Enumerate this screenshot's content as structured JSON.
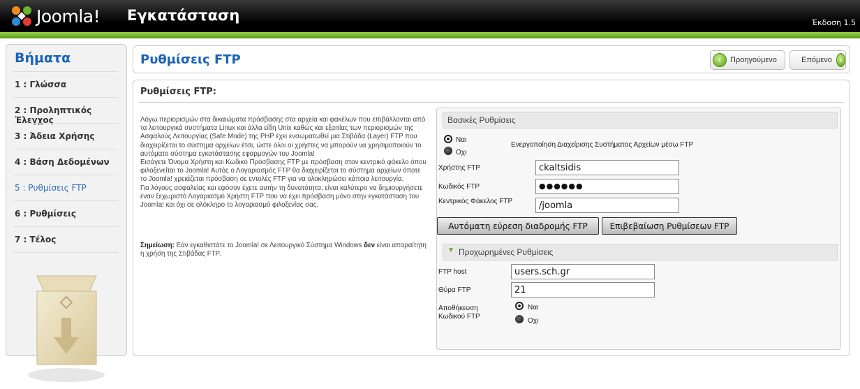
{
  "header": {
    "brand": "Joomla!",
    "title": "Εγκατάσταση",
    "version": "Έκδοση 1.5"
  },
  "sidebar": {
    "heading": "Βήματα",
    "steps": [
      "1 : Γλώσσα",
      "2 : Προληπτικός Έλεγχος",
      "3 : Άδεια Χρήσης",
      "4 : Βάση Δεδομένων",
      "5 : Ρυθμίσεις FTP",
      "6 : Ρυθμίσεις",
      "7 : Τέλος"
    ]
  },
  "topbar": {
    "title": "Ρυθμίσεις FTP",
    "prev_label": "Προηγούμενο",
    "next_label": "Επόμενο"
  },
  "main": {
    "heading": "Ρυθμίσεις FTP:",
    "description": "Λόγω περιορισμών στα δικαιώματα πρόσβασης στα αρχεία και φακέλων που επιβάλλονται από τα λειτουργικά συστήματα Linux και άλλα είδη Unix καθώς και εξαιτίας των περιορισμών της Ασφαλούς Λειτουργίας (Safe Mode) της PHP έχει ενσωματωθεί μια Στιβάδα (Layer) FTP που διαχειρίζεται το σύστημα αρχείων έτσι, ώστε όλοι οι χρήστες να μπορούν να χρησιμοποιούν το αυτόματο σύστημα εγκατάστασης εφαρμογών του Joomla!",
    "description2": "Εισάγετε Όνομα Χρήστη και Κωδικό Πρόσβασης FTP με πρόσβαση στον κεντρικό φάκελο όπου φιλοξενείται το Joomla! Αυτός ο Λογαριασμός FTP θα διαχειρίζεται το σύστημα αρχείων όποτε το Joomla! χρειάζεται πρόσβαση σε εντολές FTP για να ολοκληρώσει κάποια λειτουργία.",
    "description3": "Για λόγους ασφαλείας και εφόσον έχετε αυτήν τη δυνατότητα, είναι καλύτερο να δημιουργήσετε έναν ξεχωριστό Λογαριασμό Χρήστη FTP που να έχει πρόσβαση μόνο στην εγκατάσταση του Joomla! και όχι σε ολόκληρο το λογαριασμό φιλοξενίας σας.",
    "note_label": "Σημείωση:",
    "note_text_a": "Εάν εγκαθιστάτε το Joomla! σε Λειτουργικό Σύστημα Windows",
    "note_bold": "δεν",
    "note_text_b": "είναι απαραίτητη η χρήση της Στιβάδας FTP."
  },
  "basic": {
    "heading": "Βασικές Ρυθμίσεις",
    "yes": "Ναι",
    "no": "Οχι",
    "enable_label": "Ενεργοποίηση Διαχείρισης Συστήματος Αρχείων μέσω FTP",
    "user_label": "Χρήστης FTP",
    "user_value": "ckaltsidis",
    "pass_label": "Κωδικός FTP",
    "pass_value": "●●●●●●",
    "root_label": "Κεντρικός Φάκελος FTP",
    "root_value": "/joomla",
    "autofind_label": "Αυτόματη εύρεση διαδρομής FTP",
    "verify_label": "Επιβεβαίωση Ρυθμίσεων FTP"
  },
  "advanced": {
    "heading": "Προχωρημένες Ρυθμίσεις",
    "host_label": "FTP host",
    "host_value": "users.sch.gr",
    "port_label": "Θύρα FTP",
    "port_value": "21",
    "save_label": "Αποθήκευση Κωδικού FTP",
    "yes": "Ναι",
    "no": "Οχι"
  },
  "colors": {
    "accent": "#1a63b6",
    "green": "#6aaa22"
  }
}
